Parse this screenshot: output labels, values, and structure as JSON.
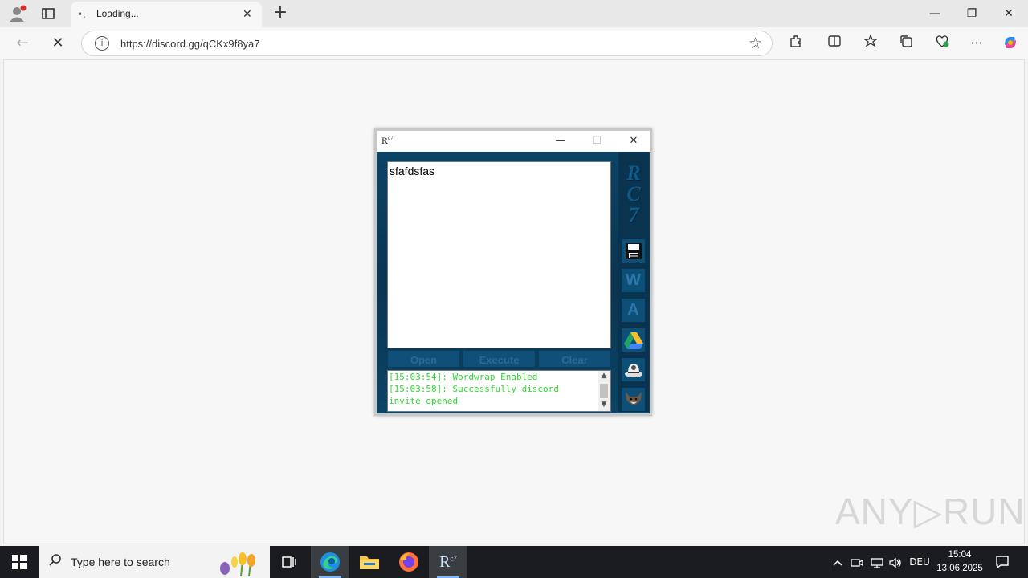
{
  "browser": {
    "tab": {
      "title": "Loading...",
      "close_glyph": "✕",
      "favicon_glyph": "•."
    },
    "new_tab_glyph": "+",
    "window_controls": {
      "minimize": "—",
      "restore": "❐",
      "close": "✕"
    },
    "nav": {
      "back": "←",
      "reload": "✕"
    },
    "address": {
      "url": "https://discord.gg/qCKx9f8ya7",
      "info_glyph": "i",
      "star_glyph": "☆"
    },
    "toolbar": {
      "extensions": "⧉",
      "split": "◫",
      "favorites": "☆",
      "collections": "⧉",
      "performance": "♡",
      "menu": "···"
    }
  },
  "app": {
    "title_logo": "R",
    "title_logo_sup": "c7",
    "controls": {
      "minimize": "—",
      "maximize": "☐",
      "close": "✕"
    },
    "editor_text": "sfafdsfas",
    "buttons": {
      "open": "Open",
      "execute": "Execute",
      "clear": "Clear"
    },
    "console_lines": [
      "[15:03:54]: Wordwrap Enabled",
      "[15:03:58]: Successfully discord",
      "invite opened"
    ],
    "sidebar": {
      "logo_text": [
        "R",
        "C",
        "7"
      ],
      "wordwrap_label": "W",
      "autoattach_label": "A"
    },
    "colors": {
      "console_text": "#33d633",
      "panel": "#0a3a55"
    }
  },
  "watermark": "ANY▷RUN",
  "taskbar": {
    "search_placeholder": "Type here to search",
    "tray": {
      "language": "DEU",
      "chevron": "^"
    },
    "clock": {
      "time": "15:04",
      "date": "13.06.2025"
    },
    "app_label": "R",
    "app_label_sup": "c7"
  }
}
